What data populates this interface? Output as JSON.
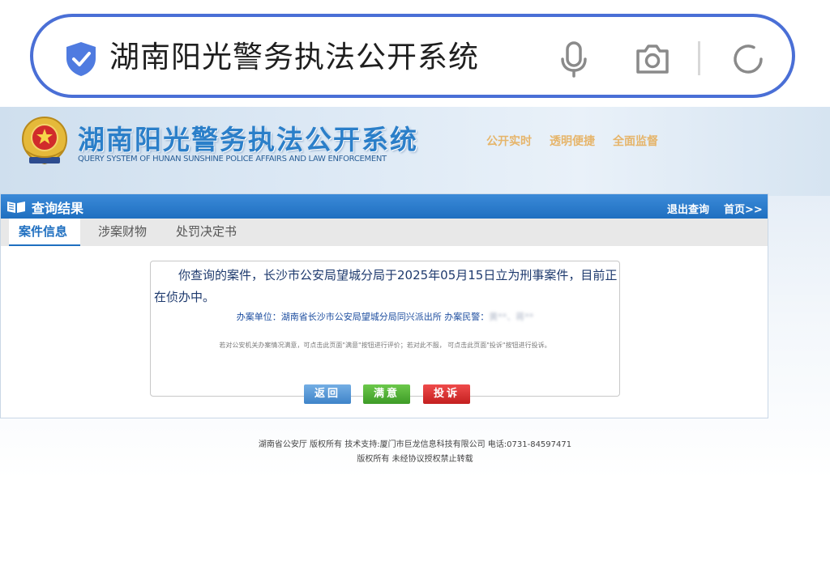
{
  "search": {
    "query": "湖南阳光警务执法公开系统"
  },
  "header": {
    "title": "湖南阳光警务执法公开系统",
    "subtitle": "QUERY SYSTEM OF HUNAN SUNSHINE POLICE AFFAIRS AND LAW ENFORCEMENT",
    "slogans": [
      "公开实时",
      "透明便捷",
      "全面监督"
    ]
  },
  "panel": {
    "title": "查询结果",
    "logout_link": "退出查询",
    "home_link": "首页>>",
    "tabs": [
      {
        "label": "案件信息",
        "active": true
      },
      {
        "label": "涉案财物",
        "active": false
      },
      {
        "label": "处罚决定书",
        "active": false
      }
    ]
  },
  "result": {
    "message": "你查询的案件，长沙市公安局望城分局于2025年05月15日立为刑事案件，目前正在侦办中。",
    "org_label": "办案单位：",
    "org_value": "湖南省长沙市公安局望城分局同兴派出所",
    "officer_label": "办案民警：",
    "officer_value": "黄**、蒋**",
    "hint": "若对公安机关办案情况满意，可点击此页面\"满意\"按钮进行评价；若对此不服， 可点击此页面\"投诉\"按钮进行投诉。",
    "buttons": {
      "back": "返回",
      "satisfied": "满意",
      "complain": "投诉"
    }
  },
  "footer": {
    "line1": "湖南省公安厅 版权所有 技术支持:厦门市巨龙信息科技有限公司 电话:0731-84597471",
    "line2": "版权所有 未经协议授权禁止转载"
  },
  "colors": {
    "accent": "#1f6fc0",
    "search_border": "#4a6fd6",
    "ok_button": "#3e9b27",
    "complain_button": "#c42020"
  }
}
